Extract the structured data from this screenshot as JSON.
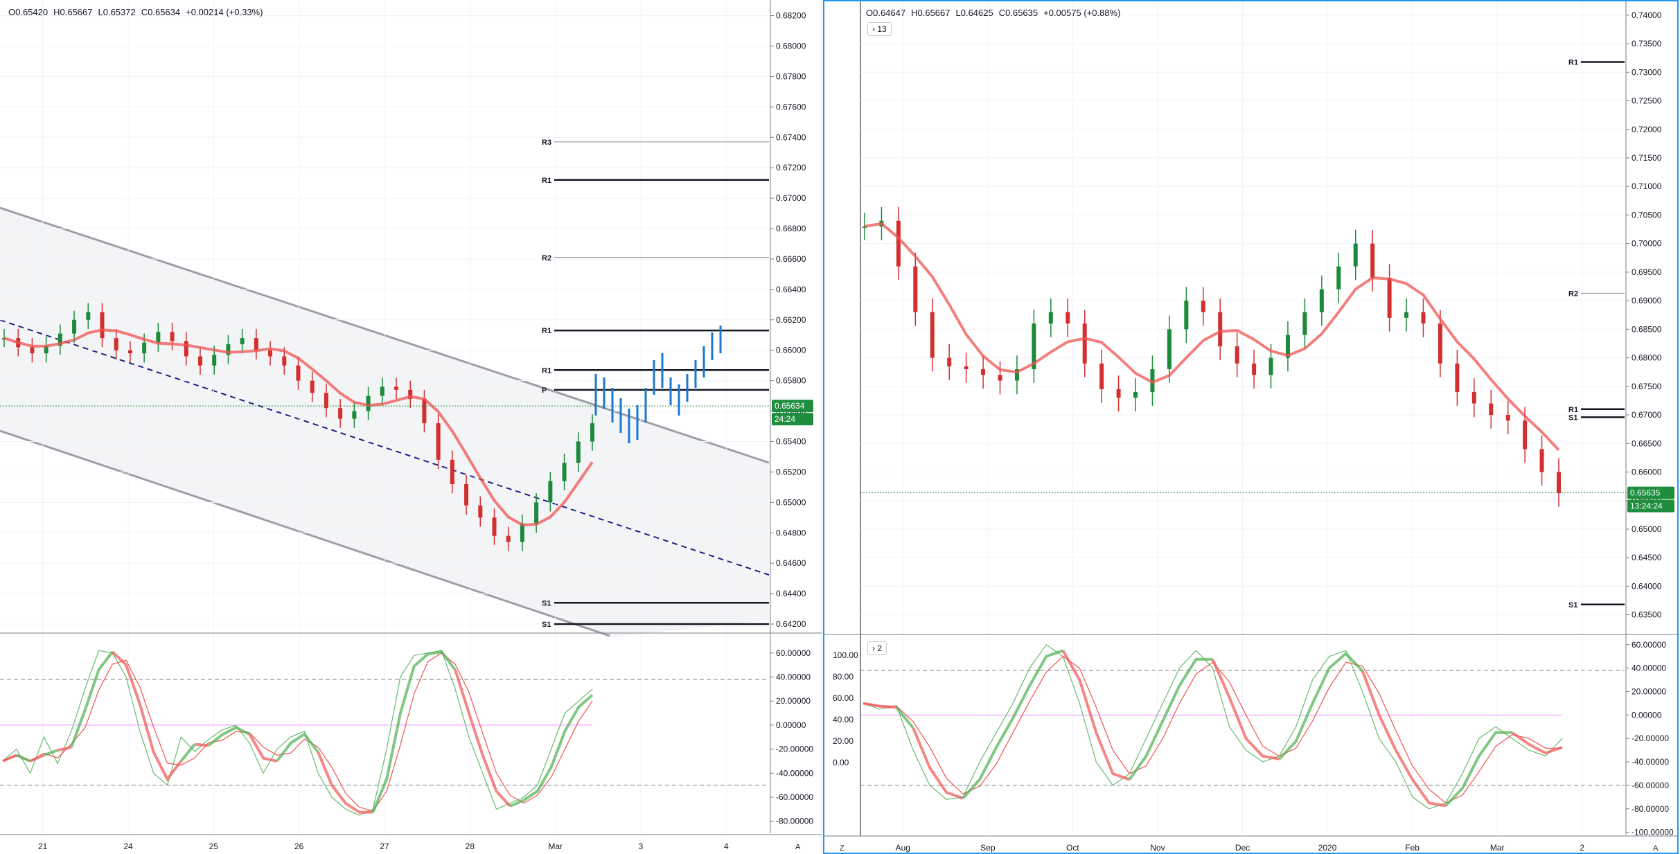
{
  "left": {
    "ohlc": {
      "o": "O0.65420",
      "h": "H0.65667",
      "l": "L0.65372",
      "c": "C0.65634",
      "chg": "+0.00214 (+0.33%)"
    },
    "price_label": "0.65634",
    "countdown": "24:24",
    "x_labels": [
      "21",
      "24",
      "25",
      "26",
      "27",
      "28",
      "Mar",
      "3",
      "4"
    ],
    "axis_button": "A"
  },
  "right": {
    "ohlc": {
      "o": "O0.64647",
      "h": "H0.65667",
      "l": "L0.64625",
      "c": "C0.65635",
      "chg": "+0.00575 (+0.88%)"
    },
    "collapse_main": "13",
    "collapse_osc": "2",
    "price_label": "0.65635",
    "countdown": "13:24:24",
    "x_labels": [
      "Aug",
      "Sep",
      "Oct",
      "Nov",
      "Dec",
      "2020",
      "Feb",
      "Mar",
      "2"
    ],
    "axis_button_left": "Z",
    "axis_button_right": "A"
  },
  "colors": {
    "bull": "#26a69a",
    "bear": "#ef5350",
    "green_line": "#4caf50",
    "red_line": "#ef5350",
    "bars": "#1976d2",
    "pivot": "#131722",
    "osc_pink": "#e040fb",
    "accent": "#2196f3",
    "price_bg": "#1e8e3e"
  },
  "chart_data": [
    {
      "type": "line",
      "title": "",
      "panel": "left-main",
      "ylim": [
        0.6415,
        0.6828
      ],
      "yticks": [
        0.682,
        0.68,
        0.678,
        0.676,
        0.674,
        0.672,
        0.67,
        0.668,
        0.666,
        0.664,
        0.662,
        0.66,
        0.658,
        0.656,
        0.654,
        0.652,
        0.65,
        0.648,
        0.646,
        0.644,
        0.642
      ],
      "ytick_labels": [
        "0.68200",
        "0.68000",
        "0.67800",
        "0.67600",
        "0.67400",
        "0.67200",
        "0.67000",
        "0.66800",
        "0.66600",
        "0.66400",
        "0.66200",
        "0.66000",
        "0.65800",
        "0.65600",
        "0.65400",
        "0.65200",
        "0.65000",
        "0.64800",
        "0.64600",
        "0.64400",
        "0.64200"
      ],
      "x_categories": [
        "21",
        "24",
        "25",
        "26",
        "27",
        "28",
        "Mar",
        "3",
        "4"
      ],
      "close_series": [
        0.6608,
        0.6602,
        0.6598,
        0.6603,
        0.6611,
        0.662,
        0.6625,
        0.6608,
        0.66,
        0.6598,
        0.6605,
        0.6612,
        0.6606,
        0.6596,
        0.659,
        0.6597,
        0.6604,
        0.6608,
        0.66,
        0.6596,
        0.659,
        0.658,
        0.6572,
        0.6562,
        0.6555,
        0.656,
        0.657,
        0.6576,
        0.6574,
        0.6568,
        0.6552,
        0.6528,
        0.6512,
        0.6498,
        0.649,
        0.6478,
        0.6474,
        0.6486,
        0.65,
        0.6514,
        0.6526,
        0.654,
        0.6552
      ],
      "pivots": [
        {
          "label": "R3",
          "value": 0.6737
        },
        {
          "label": "R1",
          "value": 0.6712
        },
        {
          "label": "R2",
          "value": 0.6661
        },
        {
          "label": "R1",
          "value": 0.6613
        },
        {
          "label": "R1",
          "value": 0.6587
        },
        {
          "label": "P",
          "value": 0.6574
        },
        {
          "label": "S1",
          "value": 0.6434
        },
        {
          "label": "S1",
          "value": 0.642
        }
      ],
      "price": 0.65634
    },
    {
      "type": "line",
      "panel": "left-osc",
      "ylim": [
        -90,
        72
      ],
      "yticks": [
        60,
        40,
        20,
        0,
        -20,
        -40,
        -60,
        -80
      ],
      "ytick_labels": [
        "60.00000",
        "40.00000",
        "20.00000",
        "0.00000",
        "-20.00000",
        "-40.00000",
        "-60.00000",
        "-80.00000"
      ],
      "levels": [
        38,
        -50
      ],
      "series": [
        {
          "values": [
            -30,
            -20,
            -40,
            -10,
            -32,
            -5,
            30,
            62,
            60,
            40,
            -5,
            -40,
            -50,
            -10,
            -22,
            -12,
            -4,
            0,
            -15,
            -40,
            -20,
            -10,
            -5,
            -40,
            -60,
            -70,
            -75,
            -70,
            -20,
            40,
            58,
            60,
            62,
            30,
            -10,
            -40,
            -70,
            -65,
            -60,
            -50,
            -20,
            10,
            20,
            30
          ]
        }
      ]
    },
    {
      "type": "line",
      "panel": "right-main",
      "ylim": [
        0.6318,
        0.7418
      ],
      "yticks": [
        0.74,
        0.735,
        0.73,
        0.725,
        0.72,
        0.715,
        0.71,
        0.705,
        0.7,
        0.695,
        0.69,
        0.685,
        0.68,
        0.675,
        0.67,
        0.665,
        0.66,
        0.655,
        0.65,
        0.645,
        0.64,
        0.635
      ],
      "ytick_labels": [
        "0.74000",
        "0.73500",
        "0.73000",
        "0.72500",
        "0.72000",
        "0.71500",
        "0.71000",
        "0.70500",
        "0.70000",
        "0.69500",
        "0.69000",
        "0.68500",
        "0.68000",
        "0.67500",
        "0.67000",
        "0.66500",
        "0.66000",
        "0.65500",
        "0.65000",
        "0.64500",
        "0.64000",
        "0.63500"
      ],
      "x_categories": [
        "Aug",
        "Sep",
        "Oct",
        "Nov",
        "Dec",
        "2020",
        "Feb",
        "Mar",
        "2"
      ],
      "close_series": [
        0.703,
        0.704,
        0.696,
        0.688,
        0.68,
        0.6785,
        0.678,
        0.677,
        0.676,
        0.678,
        0.686,
        0.688,
        0.686,
        0.679,
        0.6745,
        0.673,
        0.674,
        0.678,
        0.685,
        0.69,
        0.688,
        0.682,
        0.679,
        0.677,
        0.68,
        0.684,
        0.688,
        0.692,
        0.696,
        0.7,
        0.694,
        0.687,
        0.688,
        0.686,
        0.679,
        0.674,
        0.672,
        0.67,
        0.669,
        0.664,
        0.66,
        0.6563
      ],
      "pivots": [
        {
          "label": "R1",
          "value": 0.7318
        },
        {
          "label": "R2",
          "value": 0.6913
        },
        {
          "label": "R1",
          "value": 0.671
        },
        {
          "label": "S1",
          "value": 0.6696
        },
        {
          "label": "S1",
          "value": 0.6368
        }
      ],
      "price": 0.65635
    },
    {
      "type": "line",
      "panel": "right-osc",
      "ylim": [
        -102,
        64
      ],
      "yticks": [
        60,
        40,
        20,
        0,
        -20,
        -40,
        -60,
        -80,
        -100
      ],
      "ytick_labels": [
        "60.00000",
        "40.00000",
        "20.00000",
        "0.00000",
        "-20.00000",
        "-40.00000",
        "-60.00000",
        "-80.00000",
        "-100.00000"
      ],
      "left_ytick_labels": [
        "100.00",
        "80.00",
        "60.00",
        "40.00",
        "20.00",
        "0.00"
      ],
      "levels": [
        38,
        -60
      ],
      "series": [
        {
          "values": [
            10,
            5,
            8,
            -30,
            -60,
            -72,
            -70,
            -40,
            -15,
            10,
            40,
            60,
            50,
            10,
            -40,
            -60,
            -50,
            -20,
            10,
            40,
            55,
            40,
            -10,
            -30,
            -40,
            -35,
            -10,
            30,
            50,
            55,
            20,
            -20,
            -40,
            -70,
            -80,
            -75,
            -50,
            -20,
            -10,
            -20,
            -30,
            -35,
            -20
          ]
        }
      ]
    }
  ]
}
